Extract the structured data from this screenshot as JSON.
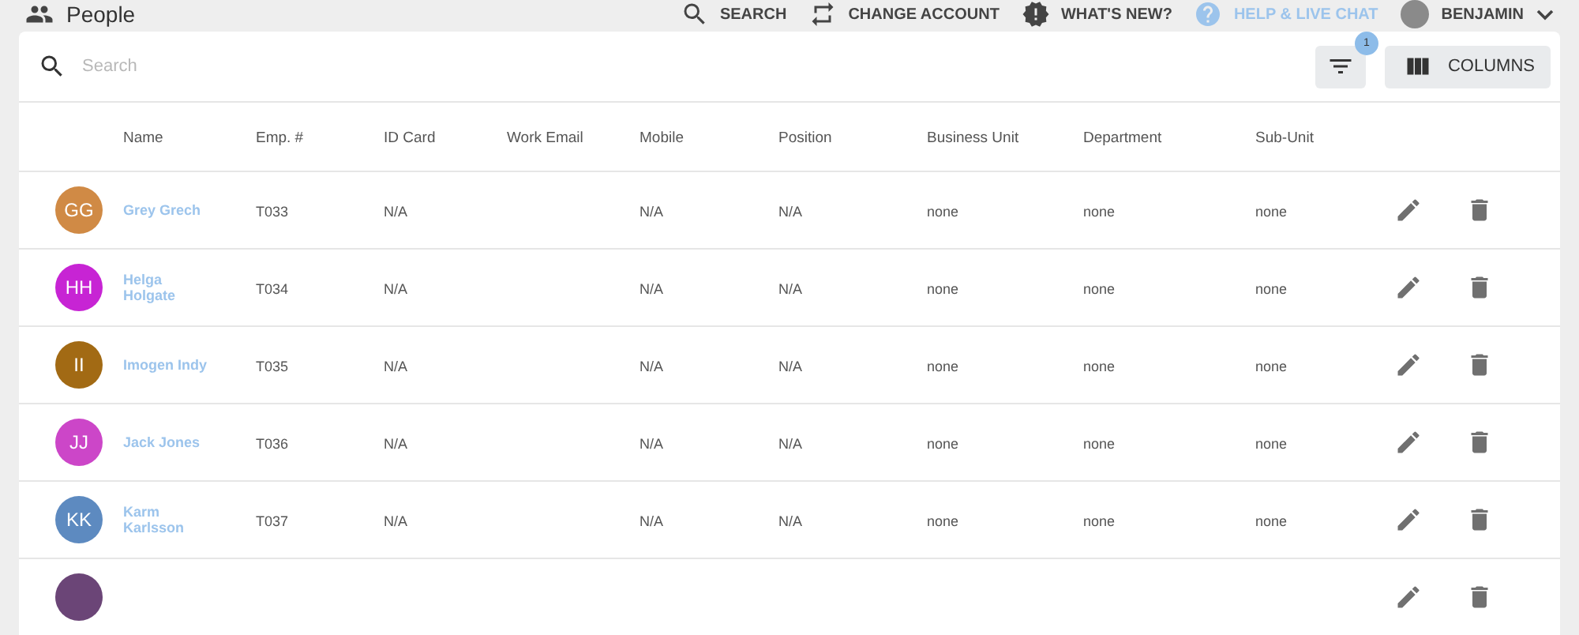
{
  "header": {
    "title": "People",
    "actions": [
      {
        "kind": "search",
        "label": "SEARCH",
        "highlighted": false
      },
      {
        "kind": "switch",
        "label": "CHANGE ACCOUNT",
        "highlighted": false
      },
      {
        "kind": "news",
        "label": "WHAT'S NEW?",
        "highlighted": false
      },
      {
        "kind": "help",
        "label": "HELP & LIVE CHAT",
        "highlighted": true
      }
    ],
    "user": {
      "name": "BENJAMIN"
    }
  },
  "toolbar": {
    "search": {
      "placeholder": "Search"
    },
    "filter_badge": "1",
    "columns_button": "COLUMNS"
  },
  "table": {
    "columns": [
      "Name",
      "Emp. #",
      "ID Card",
      "Work Email",
      "Mobile",
      "Position",
      "Business Unit",
      "Department",
      "Sub-Unit"
    ],
    "rows": [
      {
        "initials": "GG",
        "color": "#d08a45",
        "cells": [
          "Grey Grech",
          "T033",
          "N/A",
          null,
          "N/A",
          "N/A",
          "none",
          "none",
          "none"
        ]
      },
      {
        "initials": "HH",
        "color": "#c724d4",
        "cells": [
          "Helga Holgate",
          "T034",
          "N/A",
          null,
          "N/A",
          "N/A",
          "none",
          "none",
          "none"
        ]
      },
      {
        "initials": "II",
        "color": "#a26a14",
        "cells": [
          "Imogen Indy",
          "T035",
          "N/A",
          null,
          "N/A",
          "N/A",
          "none",
          "none",
          "none"
        ]
      },
      {
        "initials": "JJ",
        "color": "#cc46c8",
        "cells": [
          "Jack Jones",
          "T036",
          "N/A",
          null,
          "N/A",
          "N/A",
          "none",
          "none",
          "none"
        ]
      },
      {
        "initials": "KK",
        "color": "#5d8ac0",
        "cells": [
          "Karm Karlsson",
          "T037",
          "N/A",
          null,
          "N/A",
          "N/A",
          "none",
          "none",
          "none"
        ]
      },
      {
        "color": "#6b4577"
      }
    ]
  }
}
